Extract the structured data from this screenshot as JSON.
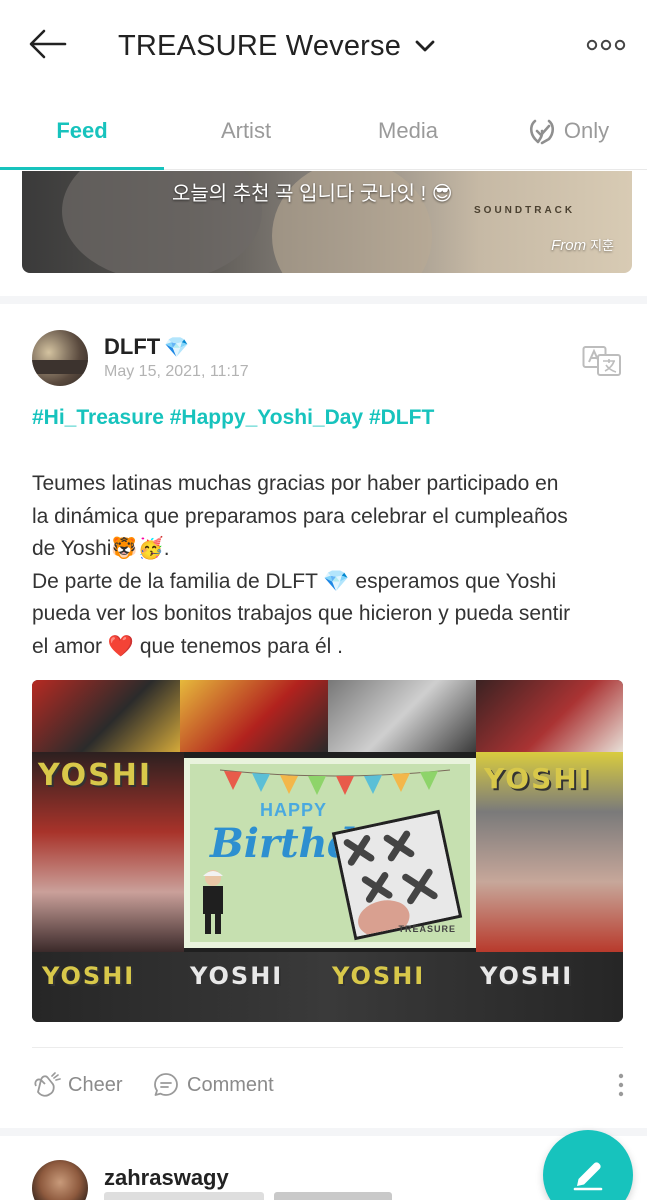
{
  "header": {
    "title": "TREASURE Weverse",
    "back_icon": "arrow-left-icon",
    "dropdown_icon": "chevron-down-icon",
    "more_icon": "more-horizontal-icon"
  },
  "tabs": [
    {
      "label": "Feed",
      "active": true
    },
    {
      "label": "Artist",
      "active": false
    },
    {
      "label": "Media",
      "active": false
    },
    {
      "label": "Only",
      "active": false,
      "icon": "weverse-only-icon"
    }
  ],
  "top_card": {
    "caption": "오늘의 추천 곡 입니다 굿나잇 ! 😎",
    "soundtrack_label": "SOUNDTRACK",
    "from_label": "From",
    "from_name": "지훈"
  },
  "post": {
    "author": "DLFT",
    "author_badge": "💎",
    "date": "May 15, 2021, 11:17",
    "hashtags": "#Hi_Treasure #Happy_Yoshi_Day #DLFT",
    "body_lines": [
      "Teumes latinas muchas gracias por haber participado en",
      "la dinámica que preparamos para celebrar el cumpleaños",
      "de Yoshi🐯🥳.",
      "De parte de la familia de DLFT 💎 esperamos que Yoshi",
      "pueda ver los bonitos trabajos que hicieron y pueda sentir",
      "el amor ❤️ que tenemos para él ."
    ],
    "image": {
      "happy": "HAPPY",
      "birthday": "Birthday",
      "yoshi": "YOSHI",
      "treasure_logo": "TREASURE"
    },
    "actions": {
      "cheer": "Cheer",
      "comment": "Comment"
    }
  },
  "next_post": {
    "author": "zahraswagy"
  },
  "fab": {
    "icon": "pencil-icon"
  },
  "colors": {
    "accent": "#17c3bd",
    "muted": "#9a9a9a"
  }
}
